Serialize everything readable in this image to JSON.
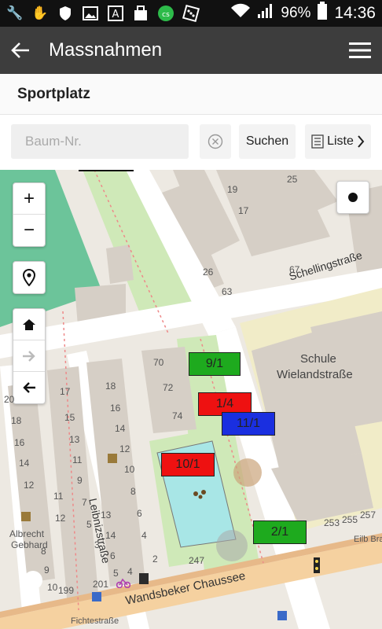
{
  "status_bar": {
    "battery": "96%",
    "time": "14:36",
    "icons": [
      "wrench-icon",
      "glove-icon",
      "shield-icon",
      "image-icon",
      "font-a-icon",
      "bag-icon",
      "cloud-icon",
      "dice-icon",
      "wifi-icon",
      "signal-icon",
      "battery-icon"
    ]
  },
  "app_bar": {
    "title": "Massnahmen"
  },
  "sub_header": {
    "title": "Sportplatz"
  },
  "search": {
    "placeholder": "Baum-Nr.",
    "search_label": "Suchen",
    "list_label": "Liste"
  },
  "map": {
    "tree_labels": [
      {
        "text": "9/1",
        "color": "green"
      },
      {
        "text": "1/4",
        "color": "red"
      },
      {
        "text": "11/1",
        "color": "blue"
      },
      {
        "text": "10/1",
        "color": "red"
      },
      {
        "text": "2/1",
        "color": "green"
      }
    ],
    "streets": [
      "Schellingstraße",
      "Leibnizstraße",
      "Wandsbeker Chaussee",
      "Fichtestraße"
    ],
    "school": [
      "Schule",
      "Wielandstraße"
    ],
    "poi": [
      "Albrecht",
      "Gebhard"
    ],
    "house_numbers": [
      "25",
      "19",
      "17",
      "26",
      "67",
      "63",
      "70",
      "72",
      "74",
      "17",
      "18",
      "16",
      "15",
      "14",
      "13",
      "12",
      "11",
      "10",
      "9",
      "8",
      "7",
      "6",
      "5",
      "4",
      "3",
      "2",
      "247",
      "18",
      "16",
      "14",
      "12",
      "199",
      "201",
      "253",
      "255",
      "257",
      "20",
      "11",
      "12",
      "13",
      "14",
      "8",
      "9",
      "10",
      "6",
      "5",
      "4"
    ],
    "partial_text": [
      "Eilb Bra"
    ]
  },
  "map_controls": {
    "zoom_in": "+",
    "zoom_out": "−"
  }
}
